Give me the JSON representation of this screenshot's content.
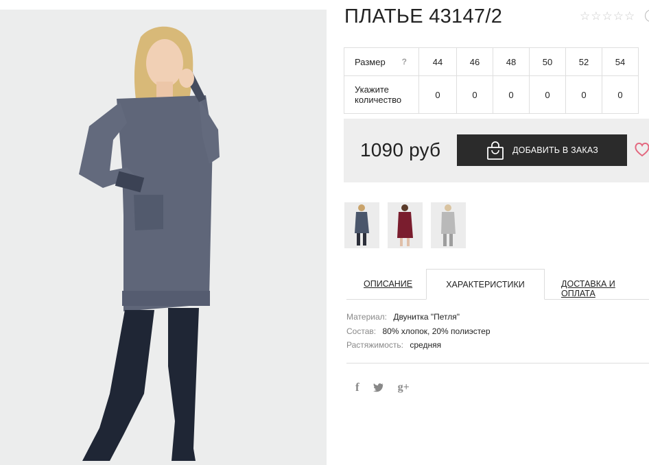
{
  "product": {
    "title": "ПЛАТЬЕ 43147/2",
    "rating_stars": 5,
    "rating_value": 0
  },
  "sizes": {
    "size_label": "Размер",
    "help": "?",
    "quantity_label_line1": "Укажите",
    "quantity_label_line2": "количество",
    "columns": [
      {
        "size": "44",
        "qty": "0"
      },
      {
        "size": "46",
        "qty": "0"
      },
      {
        "size": "48",
        "qty": "0"
      },
      {
        "size": "50",
        "qty": "0"
      },
      {
        "size": "52",
        "qty": "0"
      },
      {
        "size": "54",
        "qty": "0"
      }
    ]
  },
  "purchase": {
    "price": "1090 руб",
    "add_button": "ДОБАВИТЬ В ЗАКАЗ"
  },
  "thumbnails": [
    {
      "color": "#4a566b"
    },
    {
      "color": "#7a1d2e"
    },
    {
      "color": "#b9b9b9"
    }
  ],
  "tabs": {
    "description": "ОПИСАНИЕ",
    "characteristics": "ХАРАКТЕРИСТИКИ",
    "delivery": "ДОСТАВКА И ОПЛАТА",
    "active": "characteristics"
  },
  "characteristics": [
    {
      "key": "Материал:",
      "value": "Двунитка \"Петля\""
    },
    {
      "key": "Состав:",
      "value": "80% хлопок, 20% полиэстер"
    },
    {
      "key": "Растяжимость:",
      "value": "средняя"
    }
  ],
  "social": [
    {
      "name": "facebook-icon",
      "glyph": "f"
    },
    {
      "name": "twitter-icon",
      "glyph": "t"
    },
    {
      "name": "google-plus-icon",
      "glyph": "g+"
    }
  ],
  "colors": {
    "button_bg": "#2b2b2b",
    "price_bar_bg": "#eeeeee",
    "heart": "#e3677e",
    "photo_bg": "#eceded"
  }
}
